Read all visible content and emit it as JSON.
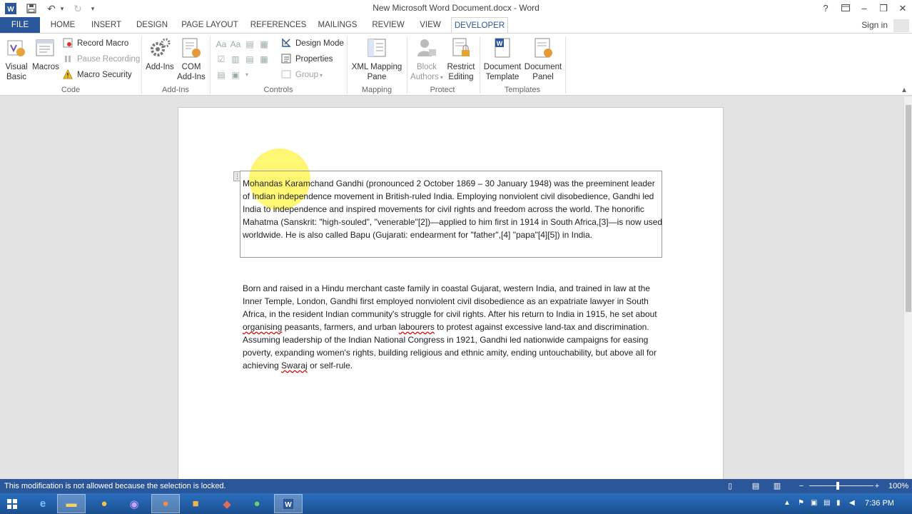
{
  "window": {
    "title": "New Microsoft Word Document.docx - Word",
    "help_icon": "?",
    "min": "–",
    "max": "❐",
    "close": "✕"
  },
  "tabs": [
    {
      "label": "FILE"
    },
    {
      "label": "HOME"
    },
    {
      "label": "INSERT"
    },
    {
      "label": "DESIGN"
    },
    {
      "label": "PAGE LAYOUT"
    },
    {
      "label": "REFERENCES"
    },
    {
      "label": "MAILINGS"
    },
    {
      "label": "REVIEW"
    },
    {
      "label": "VIEW"
    },
    {
      "label": "DEVELOPER"
    }
  ],
  "active_tab": "DEVELOPER",
  "signin": "Sign in",
  "ribbon": {
    "code": {
      "label": "Code",
      "visual_basic_1": "Visual",
      "visual_basic_2": "Basic",
      "macros": "Macros",
      "record_macro": "Record Macro",
      "pause_recording": "Pause Recording",
      "macro_security": "Macro Security"
    },
    "addins": {
      "label": "Add-Ins",
      "addins_btn": "Add-Ins",
      "com_1": "COM",
      "com_2": "Add-Ins"
    },
    "controls": {
      "label": "Controls",
      "design_mode": "Design Mode",
      "properties": "Properties",
      "group": "Group"
    },
    "mapping": {
      "label": "Mapping",
      "xml_1": "XML Mapping",
      "xml_2": "Pane"
    },
    "protect": {
      "label": "Protect",
      "block_1": "Block",
      "block_2": "Authors",
      "restrict_1": "Restrict",
      "restrict_2": "Editing"
    },
    "templates": {
      "label": "Templates",
      "doc_template_1": "Document",
      "doc_template_2": "Template",
      "doc_panel_1": "Document",
      "doc_panel_2": "Panel"
    }
  },
  "document": {
    "p1_a": "M",
    "p1_b": "ohandas Karamchand Gandhi (pronounced 2 October 1869 – 30 January 1948) was the preeminent leader of Indian independence movement in British-ruled India. Employing nonviolent civil disobedience, Gandhi led India to independence and inspired movements for civil rights and freedom across the world. The honorific Mahatma (Sanskrit: \"high-souled\", \"venerable\"[2])—applied to him first in 1914 in South Africa,[3]—is now used worldwide. He is also called Bapu (Gujarati: endearment for \"father\",[4] \"papa\"[4][5]) in India.",
    "p2_a": "Born and raised in a Hindu merchant caste family in coastal Gujarat, western India, and trained in law at the Inner Temple, London, Gandhi first employed nonviolent civil disobedience as an expatriate lawyer in South Africa, in the resident Indian community's struggle for civil rights. After his return to India in 1915, he set about ",
    "p2_sq1": "organising",
    "p2_b": " peasants, farmers, and urban ",
    "p2_sq2": "labourers",
    "p2_c": " to protest against excessive land-tax and discrimination. Assuming leadership of the Indian National Congress in 1921, Gandhi led nationwide campaigns for easing poverty, expanding women's rights, building religious and ethnic amity, ending untouchability, but above all for achieving ",
    "p2_sq3": "Swaraj",
    "p2_d": " or self-rule."
  },
  "statusbar": {
    "message": "This modification is not allowed because the selection is locked.",
    "zoom": "100%"
  },
  "taskbar": {
    "time": "7:36 PM"
  },
  "colors": {
    "accent": "#2b579a",
    "highlight": "#fff000"
  }
}
